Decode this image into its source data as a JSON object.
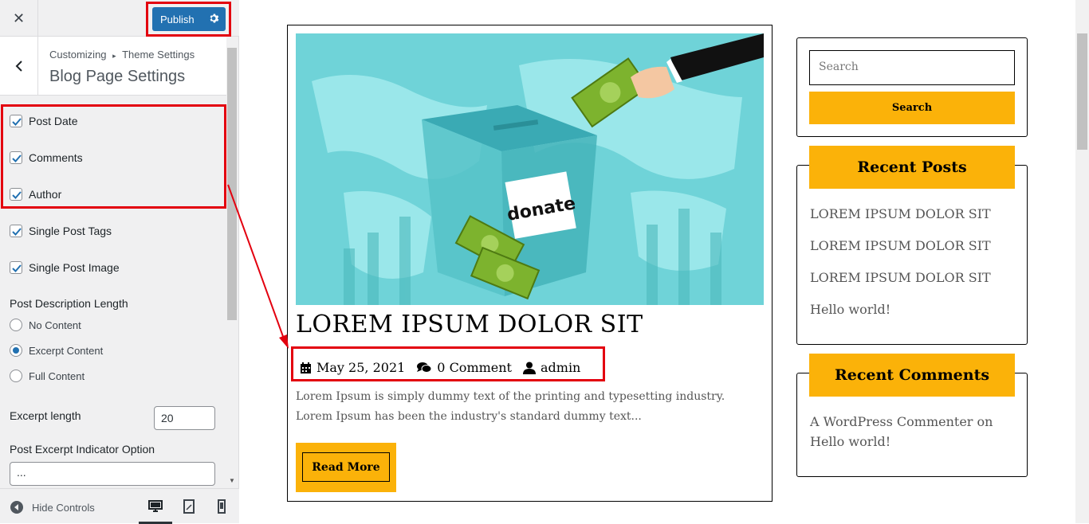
{
  "topbar": {
    "close_label": "✕",
    "publish_label": "Publish"
  },
  "section": {
    "breadcrumb_root": "Customizing",
    "breadcrumb_sep": "▸",
    "breadcrumb_parent": "Theme Settings",
    "title": "Blog Page Settings"
  },
  "options": {
    "checkboxes": [
      {
        "label": "Post Date",
        "checked": true
      },
      {
        "label": "Comments",
        "checked": true
      },
      {
        "label": "Author",
        "checked": true
      },
      {
        "label": "Single Post Tags",
        "checked": true
      },
      {
        "label": "Single Post Image",
        "checked": true
      }
    ],
    "desc_length_label": "Post Description Length",
    "radios": [
      {
        "label": "No Content",
        "selected": false
      },
      {
        "label": "Excerpt Content",
        "selected": true
      },
      {
        "label": "Full Content",
        "selected": false
      }
    ],
    "excerpt_length_label": "Excerpt length",
    "excerpt_length_value": "20",
    "indicator_label": "Post Excerpt Indicator Option",
    "indicator_value": "..."
  },
  "footer": {
    "hide_controls": "Hide Controls"
  },
  "icons": [
    "close-icon",
    "gear-icon",
    "chevron-left-icon",
    "checkmark-icon",
    "collapse-icon",
    "desktop-icon",
    "tablet-icon",
    "mobile-icon",
    "calendar-icon",
    "comments-icon",
    "user-icon"
  ],
  "colors": {
    "accent": "#2271b1",
    "highlight": "#e3000f",
    "brand_yellow": "#fbb209",
    "hero_bg": "#6fd3d8"
  },
  "post": {
    "title": "LOREM IPSUM DOLOR SIT",
    "date": "May 25, 2021",
    "comments": "0 Comment",
    "author": "admin",
    "excerpt": "Lorem Ipsum is simply dummy text of the printing and typesetting industry. Lorem Ipsum has been the industry's standard dummy text...",
    "read_more": "Read More",
    "image_text": "donate"
  },
  "sidebar": {
    "search_placeholder": "Search",
    "search_button": "Search",
    "recent_posts_title": "Recent Posts",
    "recent_posts": [
      "LOREM IPSUM DOLOR SIT",
      "LOREM IPSUM DOLOR SIT",
      "LOREM IPSUM DOLOR SIT",
      "Hello world!"
    ],
    "recent_comments_title": "Recent Comments",
    "recent_comment": "A WordPress Commenter on Hello world!"
  }
}
